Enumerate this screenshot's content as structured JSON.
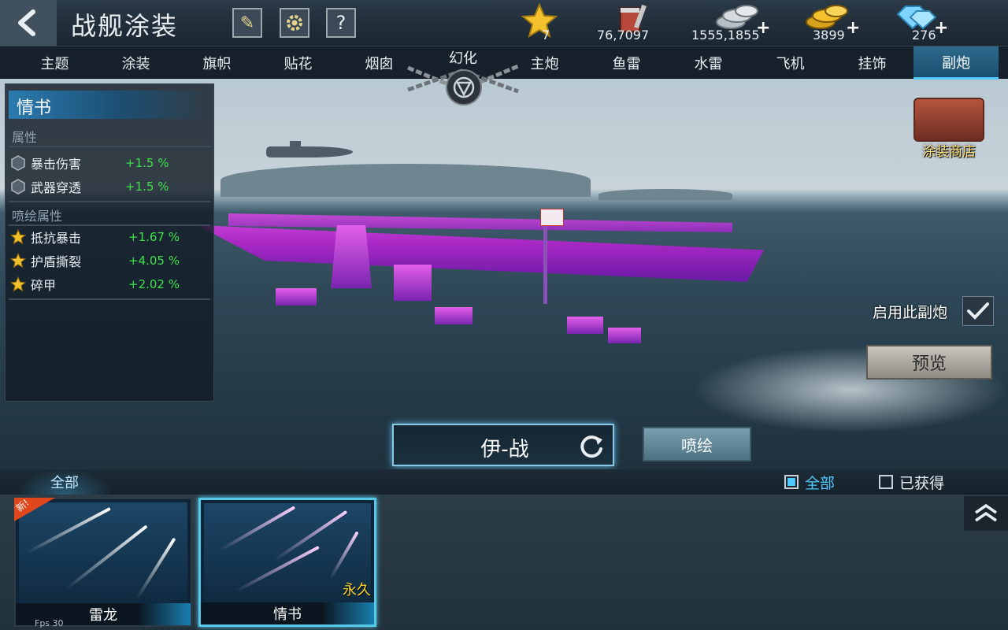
{
  "header": {
    "title": "战舰涂装",
    "resources": [
      {
        "name": "star",
        "value": "7",
        "plus": false
      },
      {
        "name": "paint",
        "value": "76,7097",
        "plus": false
      },
      {
        "name": "silver",
        "value": "1555,1855",
        "plus": true
      },
      {
        "name": "gold",
        "value": "3899",
        "plus": true
      },
      {
        "name": "diamond",
        "value": "276",
        "plus": true
      }
    ],
    "icon_buttons": [
      "brush-icon",
      "gear-icon",
      "help-icon"
    ],
    "help_label": "?"
  },
  "tabs": {
    "items": [
      "主题",
      "涂装",
      "旗帜",
      "贴花",
      "烟囱",
      "主炮",
      "鱼雷",
      "水雷",
      "飞机",
      "挂饰",
      "副炮"
    ],
    "locked_label": "幻化",
    "active": "副炮"
  },
  "info_panel": {
    "skin_name": "情书",
    "section_attrs": "属性",
    "attrs": [
      {
        "name": "暴击伤害",
        "value": "+1.5 %"
      },
      {
        "name": "武器穿透",
        "value": "+1.5 %"
      }
    ],
    "section_spray": "喷绘属性",
    "spray_attrs": [
      {
        "name": "抵抗暴击",
        "value": "+1.67 %"
      },
      {
        "name": "护盾撕裂",
        "value": "+4.05 %"
      },
      {
        "name": "碎甲",
        "value": "+2.02 %"
      }
    ]
  },
  "controls": {
    "shop_label": "涂装商店",
    "enable_label": "启用此副炮",
    "enable_checked": true,
    "preview_label": "预览",
    "ship_name": "伊-战",
    "spray_label": "喷绘"
  },
  "bottom": {
    "category_tab": "全部",
    "filter_all": "全部",
    "filter_all_checked": true,
    "filter_owned": "已获得",
    "filter_owned_checked": false,
    "cards": [
      {
        "name": "雷龙",
        "badge": "新!",
        "tag": "",
        "selected": false
      },
      {
        "name": "情书",
        "badge": "",
        "tag": "永久",
        "selected": true
      }
    ],
    "fps": "Fps 30"
  },
  "colors": {
    "accent": "#4ec8ff",
    "stat_green": "#3ee04a",
    "hull_magenta": "#d94ee0",
    "gold_text": "#ffd42a"
  }
}
